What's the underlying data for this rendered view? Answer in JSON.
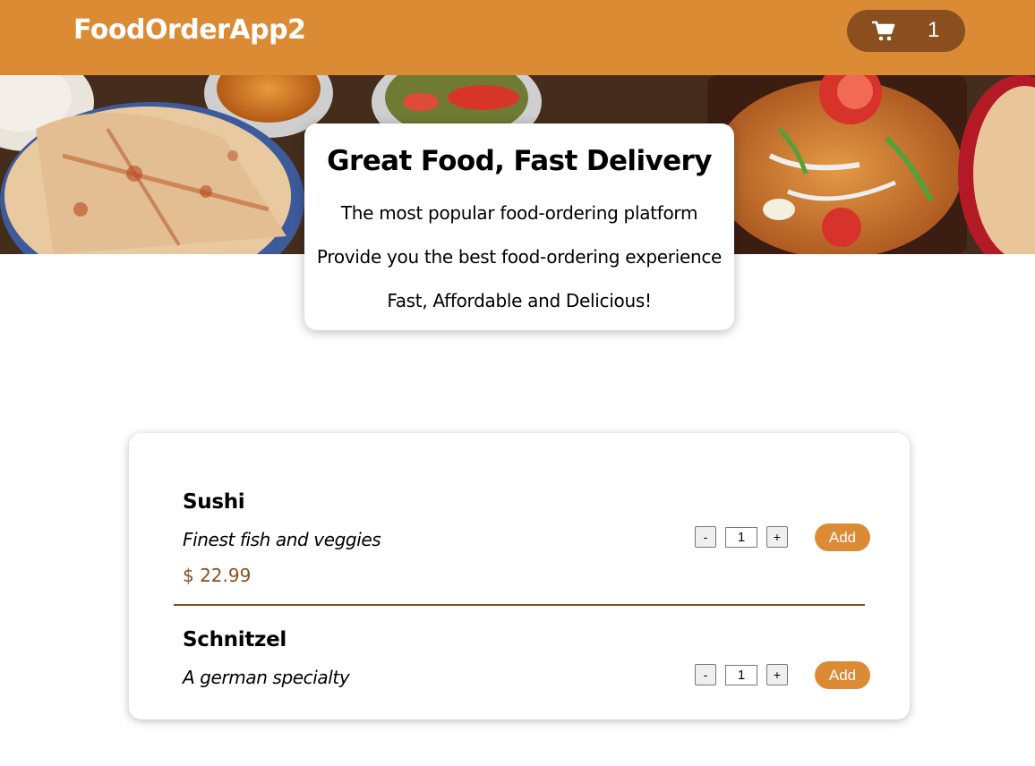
{
  "header": {
    "app_title": "FoodOrderApp2",
    "cart_icon": "shopping-cart-icon",
    "cart_count": "1"
  },
  "hero": {
    "image": "food-dishes-banner"
  },
  "summary": {
    "title": "Great Food, Fast Delivery",
    "lines": [
      "The most popular food-ordering platform",
      "Provide you the best food-ordering experience",
      "Fast, Affordable and Delicious!"
    ]
  },
  "meals": [
    {
      "name": "Sushi",
      "description": "Finest fish and veggies",
      "price": "$ 22.99",
      "quantity": "1",
      "minus_label": "-",
      "plus_label": "+",
      "add_label": "Add"
    },
    {
      "name": "Schnitzel",
      "description": "A german specialty",
      "price": "",
      "quantity": "1",
      "minus_label": "-",
      "plus_label": "+",
      "add_label": "Add"
    }
  ],
  "colors": {
    "header_bg": "#dc8b35",
    "cart_bg": "#8a4e1f",
    "price": "#8a4e1f",
    "add_button": "#dc8b35"
  }
}
